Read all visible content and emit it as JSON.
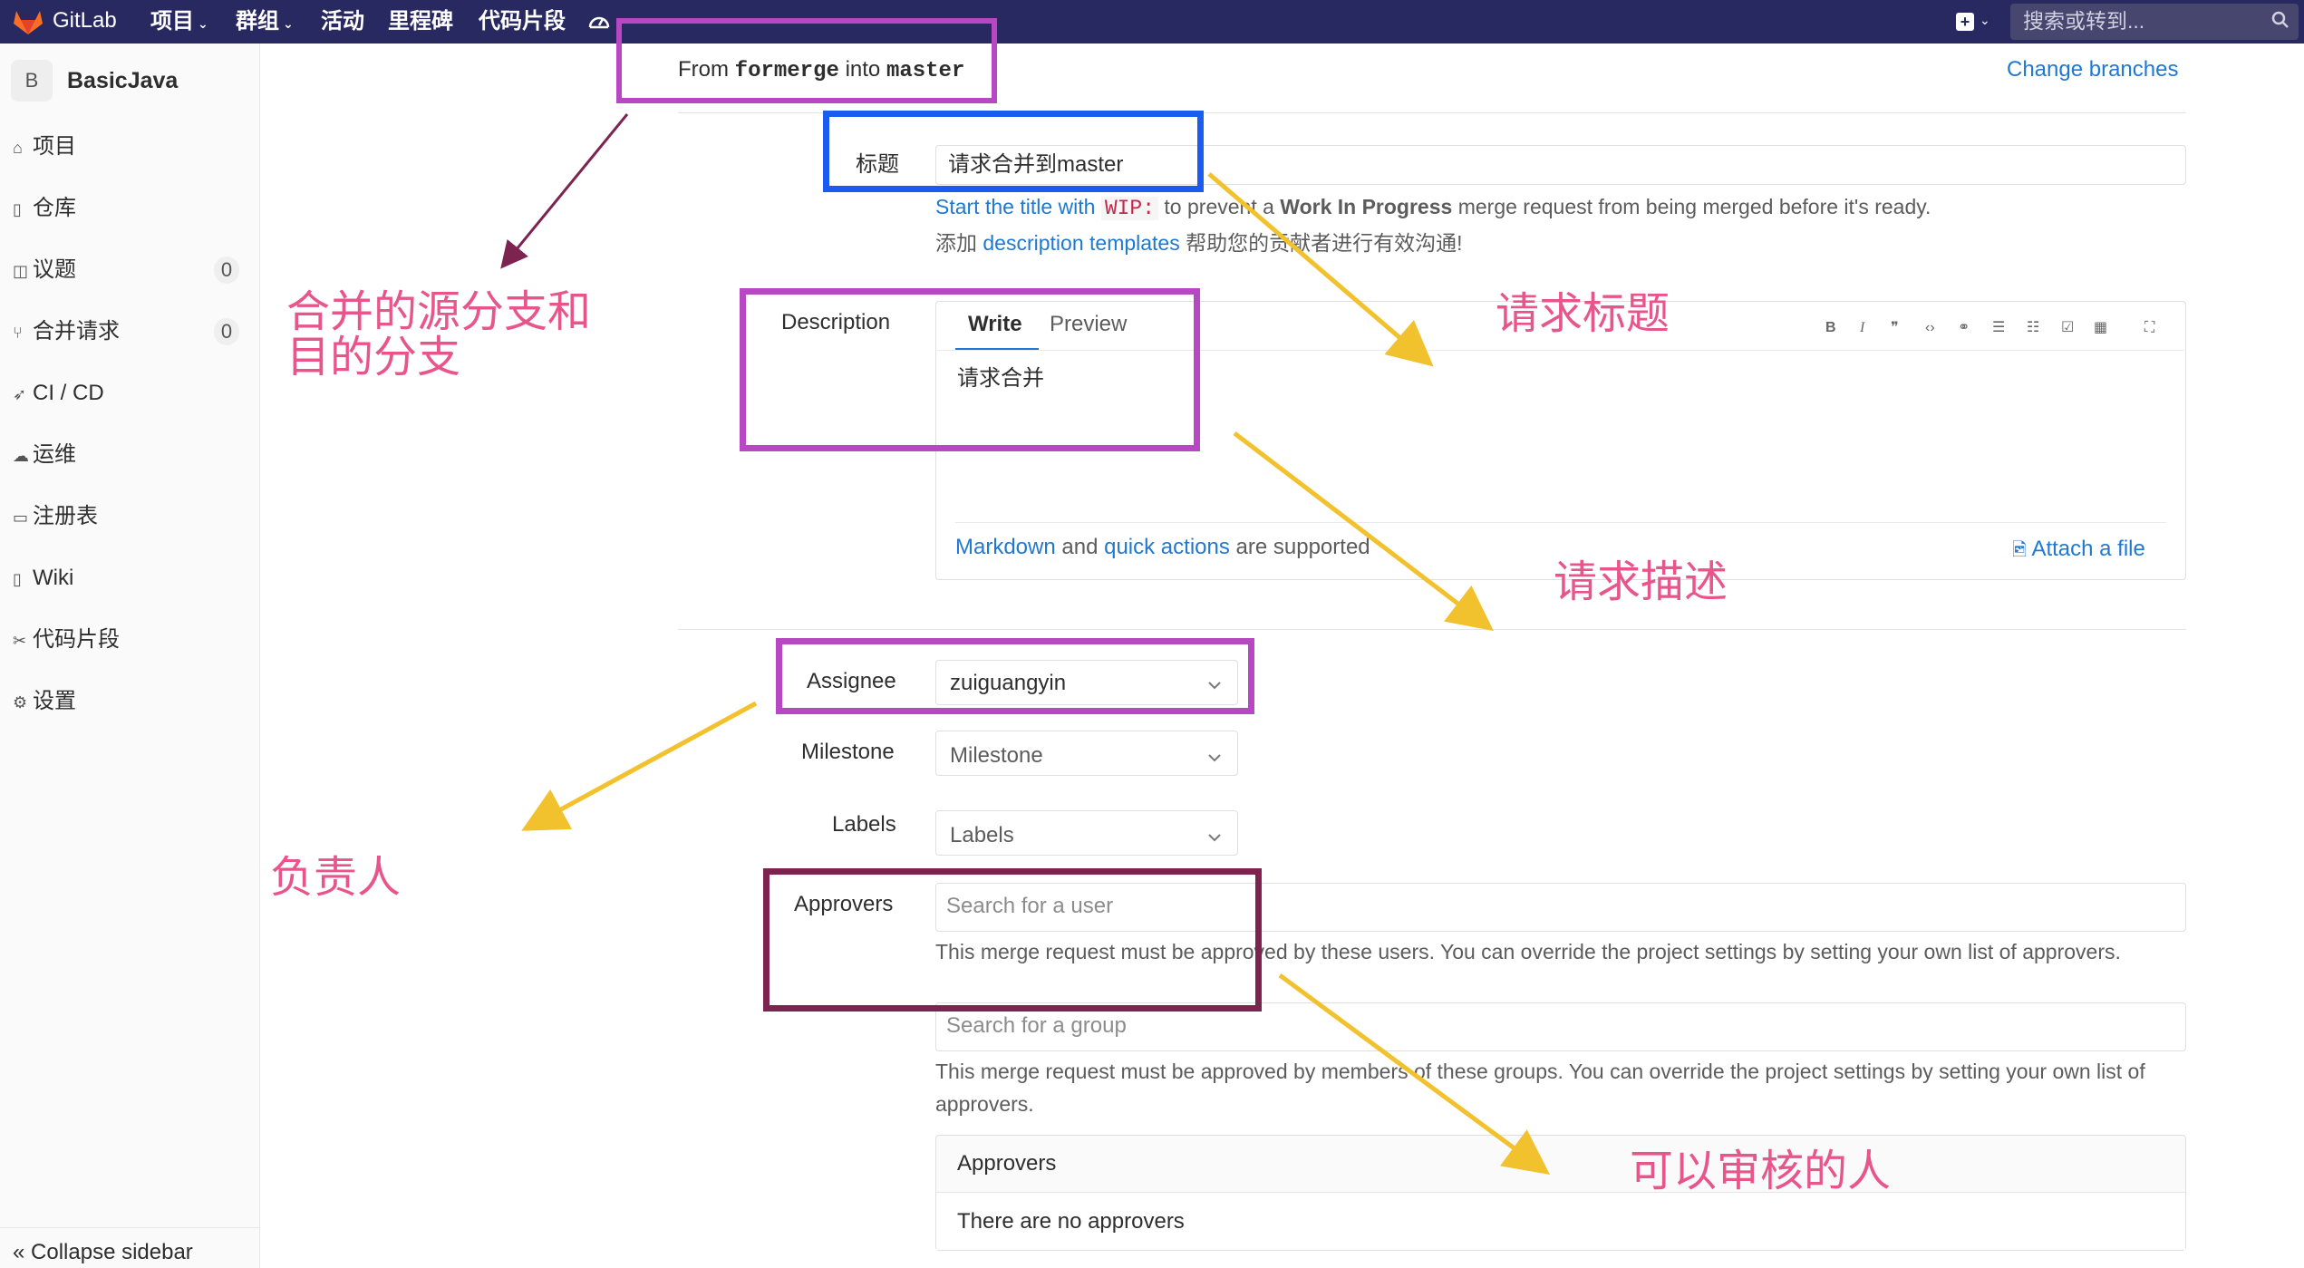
{
  "nav": {
    "brand": "GitLab",
    "items": [
      {
        "label": "项目",
        "caret": "⌄"
      },
      {
        "label": "群组",
        "caret": "⌄"
      },
      {
        "label": "活动"
      },
      {
        "label": "里程碑"
      },
      {
        "label": "代码片段"
      }
    ],
    "new_caret": "⌄",
    "search_placeholder": "搜索或转到..."
  },
  "sidebar": {
    "avatar_letter": "B",
    "project_name": "BasicJava",
    "items": [
      {
        "label": "项目",
        "icon": "home-icon"
      },
      {
        "label": "仓库",
        "icon": "doc-icon"
      },
      {
        "label": "议题",
        "icon": "issues-icon",
        "badge": "0"
      },
      {
        "label": "合并请求",
        "icon": "merge-icon",
        "badge": "0"
      },
      {
        "label": "CI / CD",
        "icon": "rocket-icon"
      },
      {
        "label": "运维",
        "icon": "cloud-icon"
      },
      {
        "label": "注册表",
        "icon": "package-icon"
      },
      {
        "label": "Wiki",
        "icon": "book-icon"
      },
      {
        "label": "代码片段",
        "icon": "scissors-icon"
      },
      {
        "label": "设置",
        "icon": "gear-icon"
      }
    ],
    "collapse_label": "Collapse sidebar"
  },
  "form": {
    "from_prefix": "From",
    "source_branch": "formerge",
    "into_word": "into",
    "target_branch": "master",
    "change_branches": "Change branches",
    "title_label": "标题",
    "title_value": "请求合并到master",
    "wip_help_1": "Start the title with",
    "wip_code": "WIP:",
    "wip_help_2": "to prevent a",
    "wip_bold": "Work In Progress",
    "wip_help_3": "merge request from being merged before it's ready.",
    "templates_prefix": "添加",
    "templates_link": "description templates",
    "templates_suffix": "帮助您的贡献者进行有效沟通!",
    "description_label": "Description",
    "tab_write": "Write",
    "tab_preview": "Preview",
    "description_value": "请求合并",
    "markdown_link": "Markdown",
    "and_word": "and",
    "quick_actions_link": "quick actions",
    "supported_text": "are supported",
    "attach_file": "Attach a file",
    "assignee_label": "Assignee",
    "assignee_value": "zuiguangyin",
    "milestone_label": "Milestone",
    "milestone_value": "Milestone",
    "labels_label": "Labels",
    "labels_value": "Labels",
    "approvers_label": "Approvers",
    "user_search_placeholder": "Search for a user",
    "user_help": "This merge request must be approved by these users. You can override the project settings by setting your own list of approvers.",
    "group_search_placeholder": "Search for a group",
    "group_help": "This merge request must be approved by members of these groups. You can override the project settings by setting your own list of approvers.",
    "approvers_panel_title": "Approvers",
    "approvers_empty": "There are no approvers"
  },
  "annotations": {
    "branches_line1": "合并的源分支和",
    "branches_line2": "目的分支",
    "title_note": "请求标题",
    "description_note": "请求描述",
    "assignee_note": "负责人",
    "approvers_note": "可以审核的人"
  },
  "colors": {
    "nav_bg": "#292961",
    "link": "#1f78d1",
    "box_purple": "#b847c4",
    "box_blue": "#1a5bf0",
    "box_maroon": "#7d2350",
    "arrow_yellow": "#f2c12e",
    "arrow_maroon": "#7d2350",
    "annotation_text": "#e8558a"
  }
}
